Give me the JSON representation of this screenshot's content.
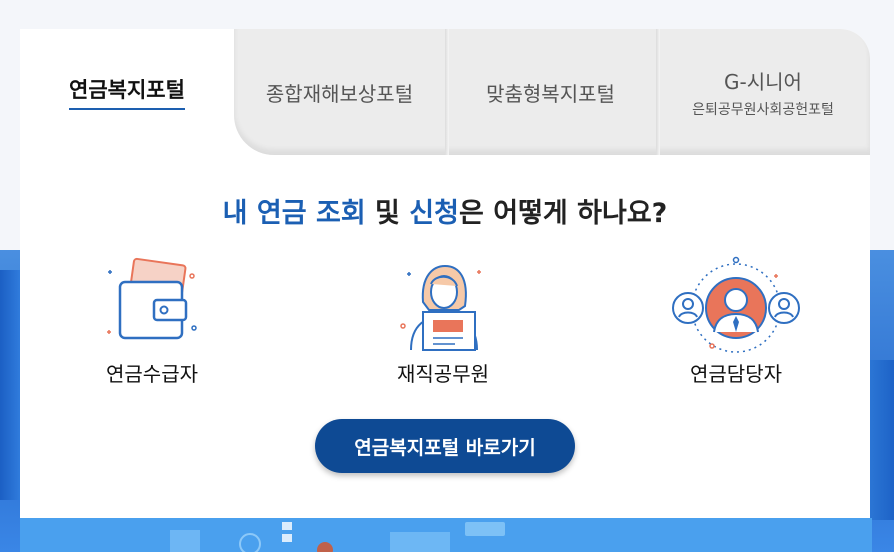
{
  "tabs": {
    "active_label": "연금복지포털",
    "items": [
      {
        "label": "종합재해보상포털",
        "sub": ""
      },
      {
        "label": "맞춤형복지포털",
        "sub": ""
      },
      {
        "label": "G-시니어",
        "sub": "은퇴공무원사회공헌포털"
      }
    ]
  },
  "headline": {
    "part1": "내 연금 조회",
    "part2": " 및 ",
    "part3": "신청",
    "part4": "은 어떻게 하나요?"
  },
  "options": [
    {
      "label": "연금수급자",
      "icon": "wallet-icon"
    },
    {
      "label": "재직공무원",
      "icon": "civil-servant-icon"
    },
    {
      "label": "연금담당자",
      "icon": "pension-manager-icon"
    }
  ],
  "cta": {
    "label": "연금복지포털 바로가기"
  },
  "colors": {
    "accent": "#1b5fb3",
    "button": "#0e4a94",
    "tab_inactive": "#ececec",
    "background_band": "#2b6fd0"
  }
}
